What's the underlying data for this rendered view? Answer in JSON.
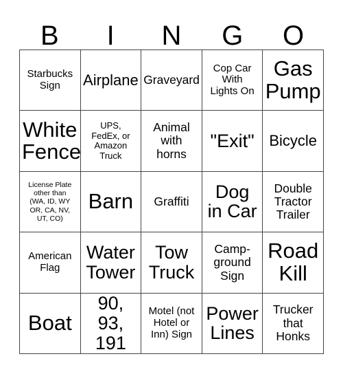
{
  "card": {
    "header_letters": [
      "B",
      "I",
      "N",
      "G",
      "O"
    ],
    "rows": [
      [
        {
          "text": "Starbucks\nSign",
          "size": "sm"
        },
        {
          "text": "Airplane",
          "size": "lg"
        },
        {
          "text": "Graveyard",
          "size": "md"
        },
        {
          "text": "Cop Car\nWith\nLights On",
          "size": "sm"
        },
        {
          "text": "Gas\nPump",
          "size": "xxl"
        }
      ],
      [
        {
          "text": "White\nFence",
          "size": "xxl"
        },
        {
          "text": "UPS,\nFedEx, or\nAmazon\nTruck",
          "size": "xs"
        },
        {
          "text": "Animal\nwith\nhorns",
          "size": "md"
        },
        {
          "text": "\"Exit\"",
          "size": "xl"
        },
        {
          "text": "Bicycle",
          "size": "lg"
        }
      ],
      [
        {
          "text": "License Plate\nother than\n(WA, ID, WY\nOR, CA, NV,\nUT, CO)",
          "size": "xxs"
        },
        {
          "text": "Barn",
          "size": "xxl"
        },
        {
          "text": "Graffiti",
          "size": "md"
        },
        {
          "text": "Dog\nin Car",
          "size": "xl"
        },
        {
          "text": "Double\nTractor\nTrailer",
          "size": "md"
        }
      ],
      [
        {
          "text": "American\nFlag",
          "size": "sm"
        },
        {
          "text": "Water\nTower",
          "size": "xl"
        },
        {
          "text": "Tow\nTruck",
          "size": "xl"
        },
        {
          "text": "Camp-\nground\nSign",
          "size": "md"
        },
        {
          "text": "Road\nKill",
          "size": "xxl"
        }
      ],
      [
        {
          "text": "Boat",
          "size": "xxl"
        },
        {
          "text": "90, 93,\n191",
          "size": "xl"
        },
        {
          "text": "Motel (not\nHotel or\nInn) Sign",
          "size": "sm"
        },
        {
          "text": "Power\nLines",
          "size": "xl"
        },
        {
          "text": "Trucker\nthat\nHonks",
          "size": "md"
        }
      ]
    ]
  }
}
